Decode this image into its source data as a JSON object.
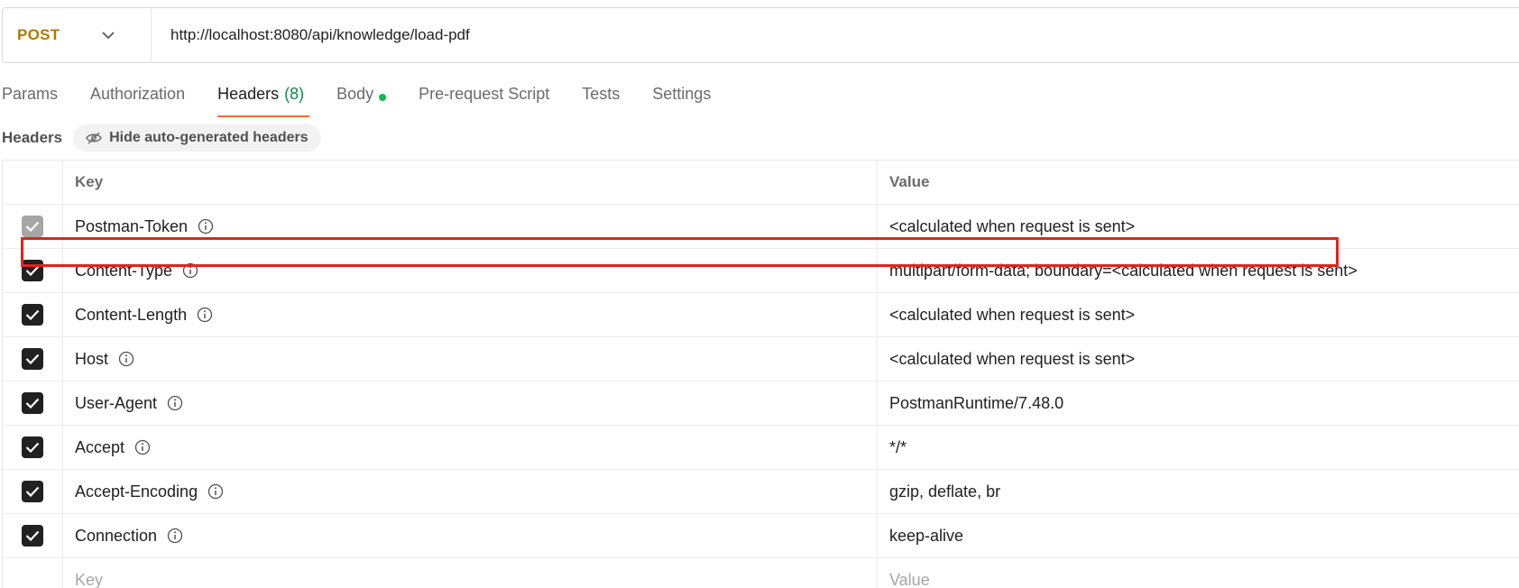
{
  "request": {
    "method": "POST",
    "url": "http://localhost:8080/api/knowledge/load-pdf"
  },
  "tabs": [
    {
      "label": "Params"
    },
    {
      "label": "Authorization"
    },
    {
      "label": "Headers",
      "count": "(8)"
    },
    {
      "label": "Body"
    },
    {
      "label": "Pre-request Script"
    },
    {
      "label": "Tests"
    },
    {
      "label": "Settings"
    }
  ],
  "headers_section": {
    "title": "Headers",
    "hide_button_label": "Hide auto-generated headers"
  },
  "table": {
    "columns": {
      "key": "Key",
      "value": "Value"
    },
    "rows": [
      {
        "key": "Postman-Token",
        "value": "<calculated when request is sent>",
        "checked": true,
        "disabled": true
      },
      {
        "key": "Content-Type",
        "value": "multipart/form-data; boundary=<calculated when request is sent>",
        "checked": true,
        "disabled": false
      },
      {
        "key": "Content-Length",
        "value": "<calculated when request is sent>",
        "checked": true,
        "disabled": false
      },
      {
        "key": "Host",
        "value": "<calculated when request is sent>",
        "checked": true,
        "disabled": false
      },
      {
        "key": "User-Agent",
        "value": "PostmanRuntime/7.48.0",
        "checked": true,
        "disabled": false
      },
      {
        "key": "Accept",
        "value": "*/*",
        "checked": true,
        "disabled": false
      },
      {
        "key": "Accept-Encoding",
        "value": "gzip, deflate, br",
        "checked": true,
        "disabled": false
      },
      {
        "key": "Connection",
        "value": "keep-alive",
        "checked": true,
        "disabled": false
      }
    ],
    "new_row": {
      "key_placeholder": "Key",
      "value_placeholder": "Value"
    }
  },
  "colors": {
    "method": "#ad7a03",
    "active_tab_underline": "#ff6c37",
    "headers_count": "#0b8a4a",
    "body_dot": "#0cbb52",
    "highlight_box": "#e0251b"
  },
  "icons": {
    "method_dropdown": "chevron-down-icon",
    "hide_button": "eye-off-icon",
    "info": "info-icon",
    "checkbox": "checkmark-icon"
  }
}
